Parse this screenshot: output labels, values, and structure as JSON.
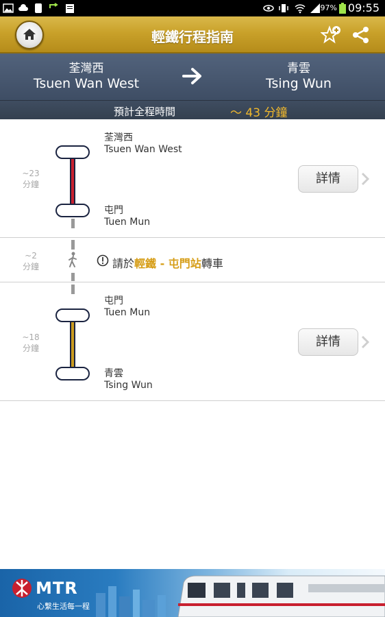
{
  "status_bar": {
    "battery": "97%",
    "time": "09:55"
  },
  "header": {
    "title": "輕鐵行程指南",
    "home_icon": "home-icon",
    "favorite_icon": "star-add-icon",
    "share_icon": "share-icon"
  },
  "route": {
    "from_zh": "荃灣西",
    "from_en": "Tsuen Wan West",
    "to_zh": "青雲",
    "to_en": "Tsing Wun",
    "duration_label": "預計全程時間",
    "duration_value": "～ 43 分鐘"
  },
  "segments": [
    {
      "duration": "~23",
      "duration_unit": "分鐘",
      "start_zh": "荃灣西",
      "start_en": "Tsuen Wan West",
      "end_zh": "屯門",
      "end_en": "Tuen Mun",
      "line_color": "#c8202f",
      "detail_label": "詳情"
    },
    {
      "duration": "~2",
      "duration_unit": "分鐘",
      "note_prefix": "請於",
      "note_highlight": "輕鐵 - 屯門站",
      "note_suffix": "轉車"
    },
    {
      "duration": "~18",
      "duration_unit": "分鐘",
      "start_zh": "屯門",
      "start_en": "Tuen Mun",
      "end_zh": "青雲",
      "end_en": "Tsing Wun",
      "line_color": "#c99a1e",
      "detail_label": "詳情"
    }
  ],
  "banner": {
    "brand": "MTR",
    "slogan": "心繫生活每一程"
  }
}
